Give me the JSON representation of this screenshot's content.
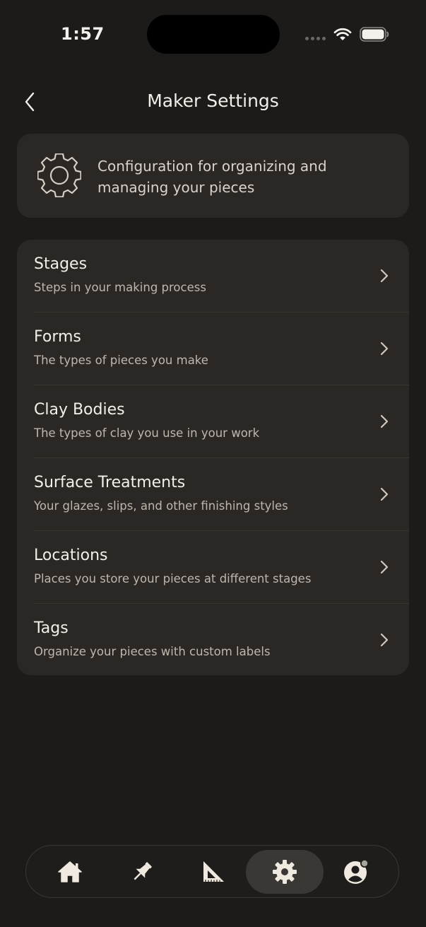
{
  "status_bar": {
    "time": "1:57"
  },
  "header": {
    "title": "Maker Settings"
  },
  "info_card": {
    "icon": "gear-outline-icon",
    "description": "Configuration for organizing and managing your pieces"
  },
  "settings": {
    "items": [
      {
        "title": "Stages",
        "subtitle": "Steps in your making process"
      },
      {
        "title": "Forms",
        "subtitle": "The types of pieces you make"
      },
      {
        "title": "Clay Bodies",
        "subtitle": "The types of clay you use in your work"
      },
      {
        "title": "Surface Treatments",
        "subtitle": "Your glazes, slips, and other finishing styles"
      },
      {
        "title": "Locations",
        "subtitle": "Places you store your pieces at different stages"
      },
      {
        "title": "Tags",
        "subtitle": "Organize your pieces with custom labels"
      }
    ]
  },
  "tab_bar": {
    "tabs": [
      {
        "icon": "home-icon",
        "active": false
      },
      {
        "icon": "pin-icon",
        "active": false
      },
      {
        "icon": "set-square-icon",
        "active": false
      },
      {
        "icon": "gear-icon",
        "active": true
      },
      {
        "icon": "profile-icon",
        "active": false
      }
    ]
  },
  "colors": {
    "background": "#1c1b19",
    "card": "#2a2724",
    "text_primary": "#f3efe9",
    "text_secondary": "#bdb7ae",
    "icon": "#efe9df",
    "notification_dot": "#a8a39c"
  }
}
